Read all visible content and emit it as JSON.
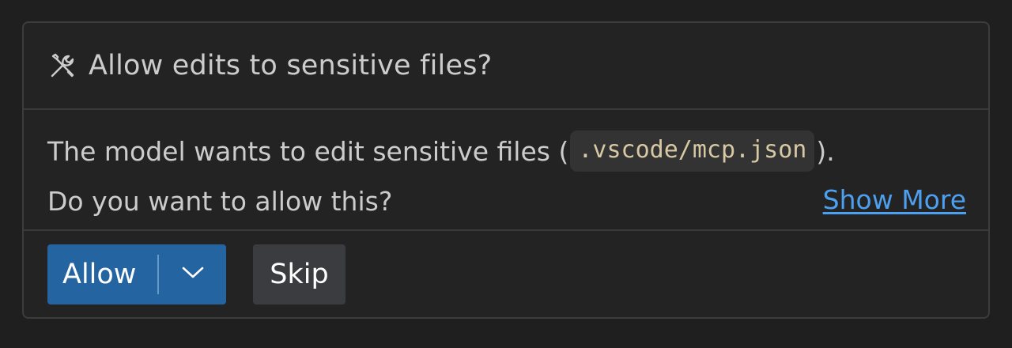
{
  "dialog": {
    "icon": "tools-icon",
    "title": "Allow edits to sensitive files?",
    "message_prefix": "The model wants to edit sensitive files (",
    "file_path": ".vscode/mcp.json",
    "message_suffix": ").",
    "question": "Do you want to allow this?",
    "show_more_label": "Show More"
  },
  "actions": {
    "allow_label": "Allow",
    "allow_dropdown_icon": "chevron-down-icon",
    "skip_label": "Skip"
  },
  "colors": {
    "background": "#1f1f1f",
    "panel": "#232323",
    "primary_button": "#2464a0",
    "secondary_button": "#3a3c40",
    "link": "#4d9ff0",
    "code_text": "#d8c9a5"
  }
}
